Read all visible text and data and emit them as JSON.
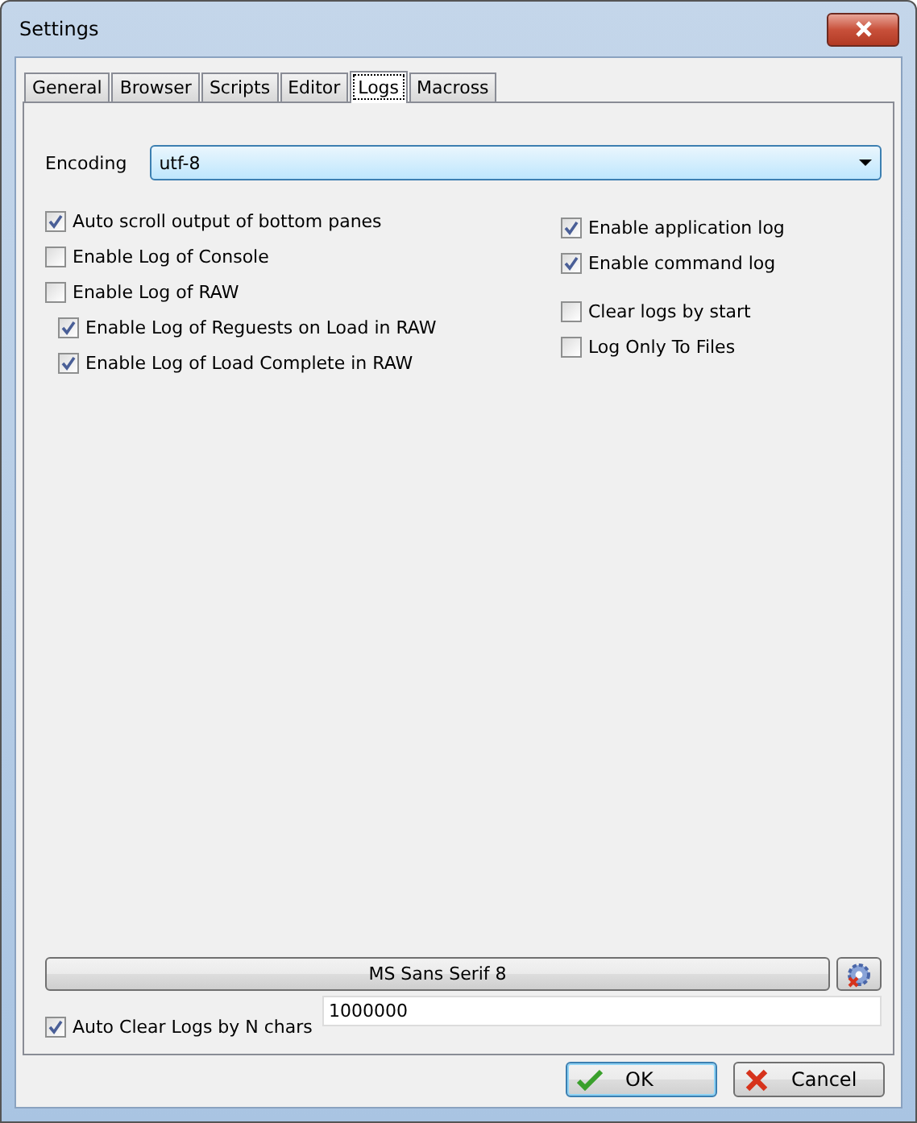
{
  "window": {
    "title": "Settings"
  },
  "tabs": [
    {
      "label": "General",
      "selected": false
    },
    {
      "label": "Browser",
      "selected": false
    },
    {
      "label": "Scripts",
      "selected": false
    },
    {
      "label": "Editor",
      "selected": false
    },
    {
      "label": "Logs",
      "selected": true
    },
    {
      "label": "Macross",
      "selected": false
    }
  ],
  "encoding": {
    "label": "Encoding",
    "value": "utf-8"
  },
  "left_options": [
    {
      "label": "Auto scroll output of bottom panes",
      "checked": true
    },
    {
      "label": "Enable Log of Console",
      "checked": false
    },
    {
      "label": "Enable Log of RAW",
      "checked": false,
      "children": [
        {
          "label": "Enable Log of Reguests on Load in RAW",
          "checked": true
        },
        {
          "label": "Enable Log of Load Complete in RAW",
          "checked": true
        }
      ]
    }
  ],
  "right_groups": [
    {
      "options": [
        {
          "label": "Enable application log",
          "checked": true
        },
        {
          "label": "Enable command log",
          "checked": true
        }
      ]
    },
    {
      "options": [
        {
          "label": "Clear logs by start",
          "checked": false
        },
        {
          "label": "Log Only To Files",
          "checked": false
        }
      ]
    }
  ],
  "font_button": {
    "label": "MS Sans Serif 8"
  },
  "auto_clear": {
    "label": "Auto Clear Logs by N chars",
    "checked": true,
    "value": "1000000"
  },
  "buttons": [
    {
      "label": "OK",
      "kind": "ok"
    },
    {
      "label": "Cancel",
      "kind": "cancel"
    }
  ]
}
